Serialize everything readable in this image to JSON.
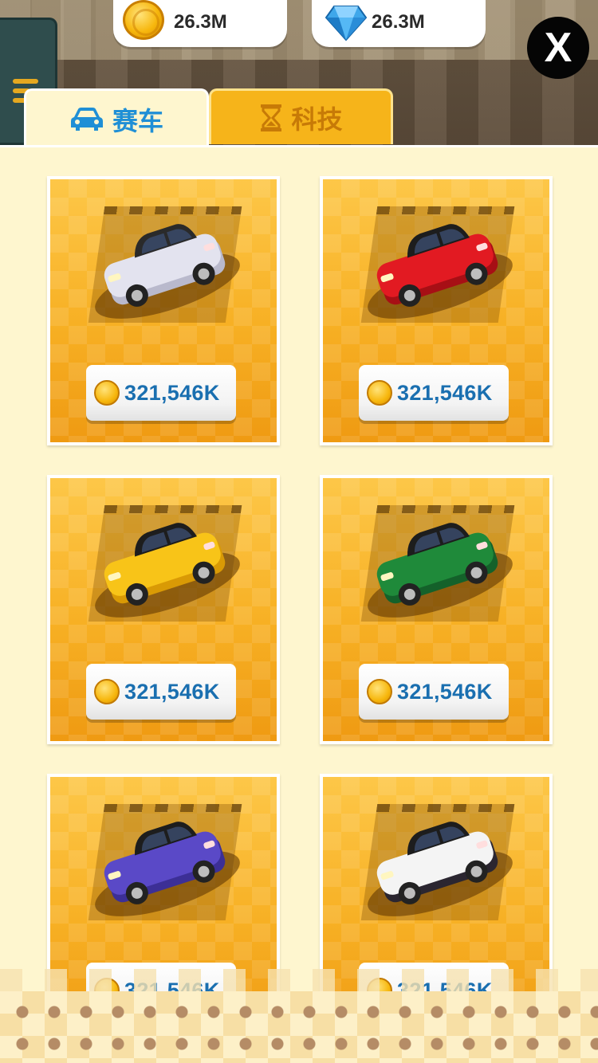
{
  "currencies": {
    "coins": {
      "value": "26.3M",
      "icon": "coin-icon"
    },
    "gems": {
      "value": "26.3M",
      "icon": "diamond-icon"
    }
  },
  "close_label": "X",
  "tabs": [
    {
      "label": "赛车",
      "icon": "car-icon",
      "active": true
    },
    {
      "label": "科技",
      "icon": "hourglass-icon",
      "active": false
    }
  ],
  "cars": [
    {
      "price": "321,546K",
      "color": "#e3e3ef",
      "accent": "#b9b9cc",
      "roof": "#2a2a2a",
      "model": "white-convertible"
    },
    {
      "price": "321,546K",
      "color": "#e21a22",
      "accent": "#a70f15",
      "roof": "#1d1d1d",
      "model": "red-sports-car"
    },
    {
      "price": "321,546K",
      "color": "#f8c418",
      "accent": "#d99a05",
      "roof": "#1d1d1d",
      "model": "yellow-muscle-car"
    },
    {
      "price": "321,546K",
      "color": "#1f8a3a",
      "accent": "#14612a",
      "roof": "#1d1d1d",
      "model": "green-muscle-car"
    },
    {
      "price": "321,546K",
      "color": "#5a49c7",
      "accent": "#3c2f96",
      "roof": "#1d1d1d",
      "model": "purple-rally-car"
    },
    {
      "price": "321,546K",
      "color": "#f4f4f4",
      "accent": "#2b2630",
      "roof": "#1d1d1d",
      "model": "black-white-coupe"
    }
  ]
}
